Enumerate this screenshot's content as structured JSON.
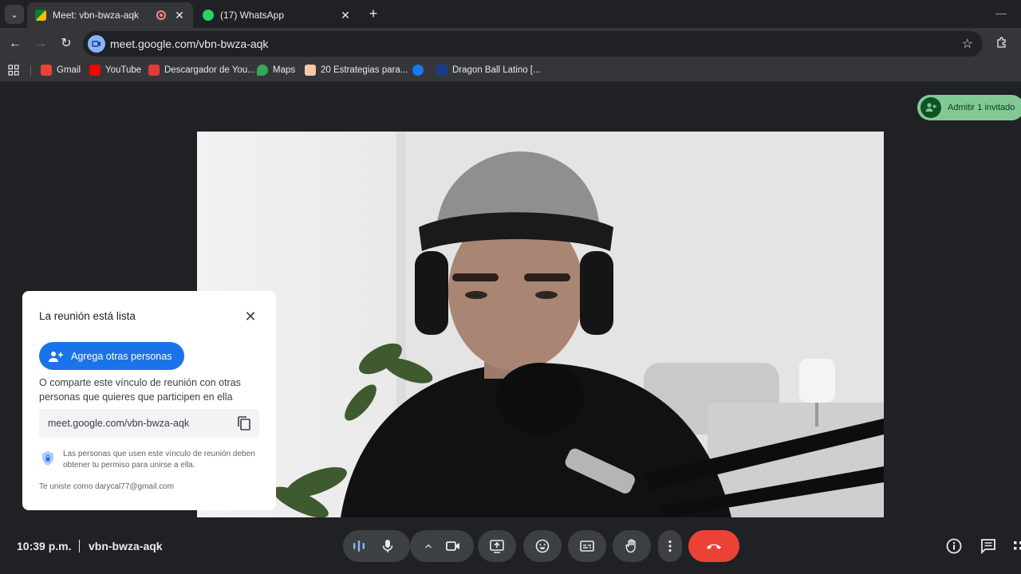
{
  "browser": {
    "tabs": [
      {
        "title": "Meet: vbn-bwza-aqk",
        "active": true,
        "recording": true
      },
      {
        "title": "(17) WhatsApp",
        "active": false
      }
    ],
    "address": "meet.google.com/vbn-bwza-aqk",
    "bookmarks": [
      {
        "label": "Gmail",
        "color": "#ea4335"
      },
      {
        "label": "YouTube",
        "color": "#ff0000"
      },
      {
        "label": "Descargador de You...",
        "color": "#e53935"
      },
      {
        "label": "Maps",
        "color": "#34a853"
      },
      {
        "label": "20 Estrategias para...",
        "color": "#f6c9a8"
      },
      {
        "label": "",
        "color": "#1877f2"
      },
      {
        "label": "Dragon Ball Latino [...",
        "color": "#1a3a8c"
      }
    ]
  },
  "meet": {
    "admit_label": "Admitir 1 invitado",
    "panel": {
      "title": "La reunión está lista",
      "add_button": "Agrega otras personas",
      "share_text": "O comparte este vínculo de reunión con otras personas que quieres que participen en ella",
      "link": "meet.google.com/vbn-bwza-aqk",
      "permission_text": "Las personas que usen este vínculo de reunión deben obtener tu permiso para unirse a ella.",
      "joined_as": "Te uniste como darycal77@gmail.com"
    },
    "time": "10:39 p.m.",
    "meeting_code": "vbn-bwza-aqk"
  },
  "colors": {
    "accent_blue": "#1a73e8",
    "end_call_red": "#ea4335",
    "admit_green": "#81c995"
  }
}
